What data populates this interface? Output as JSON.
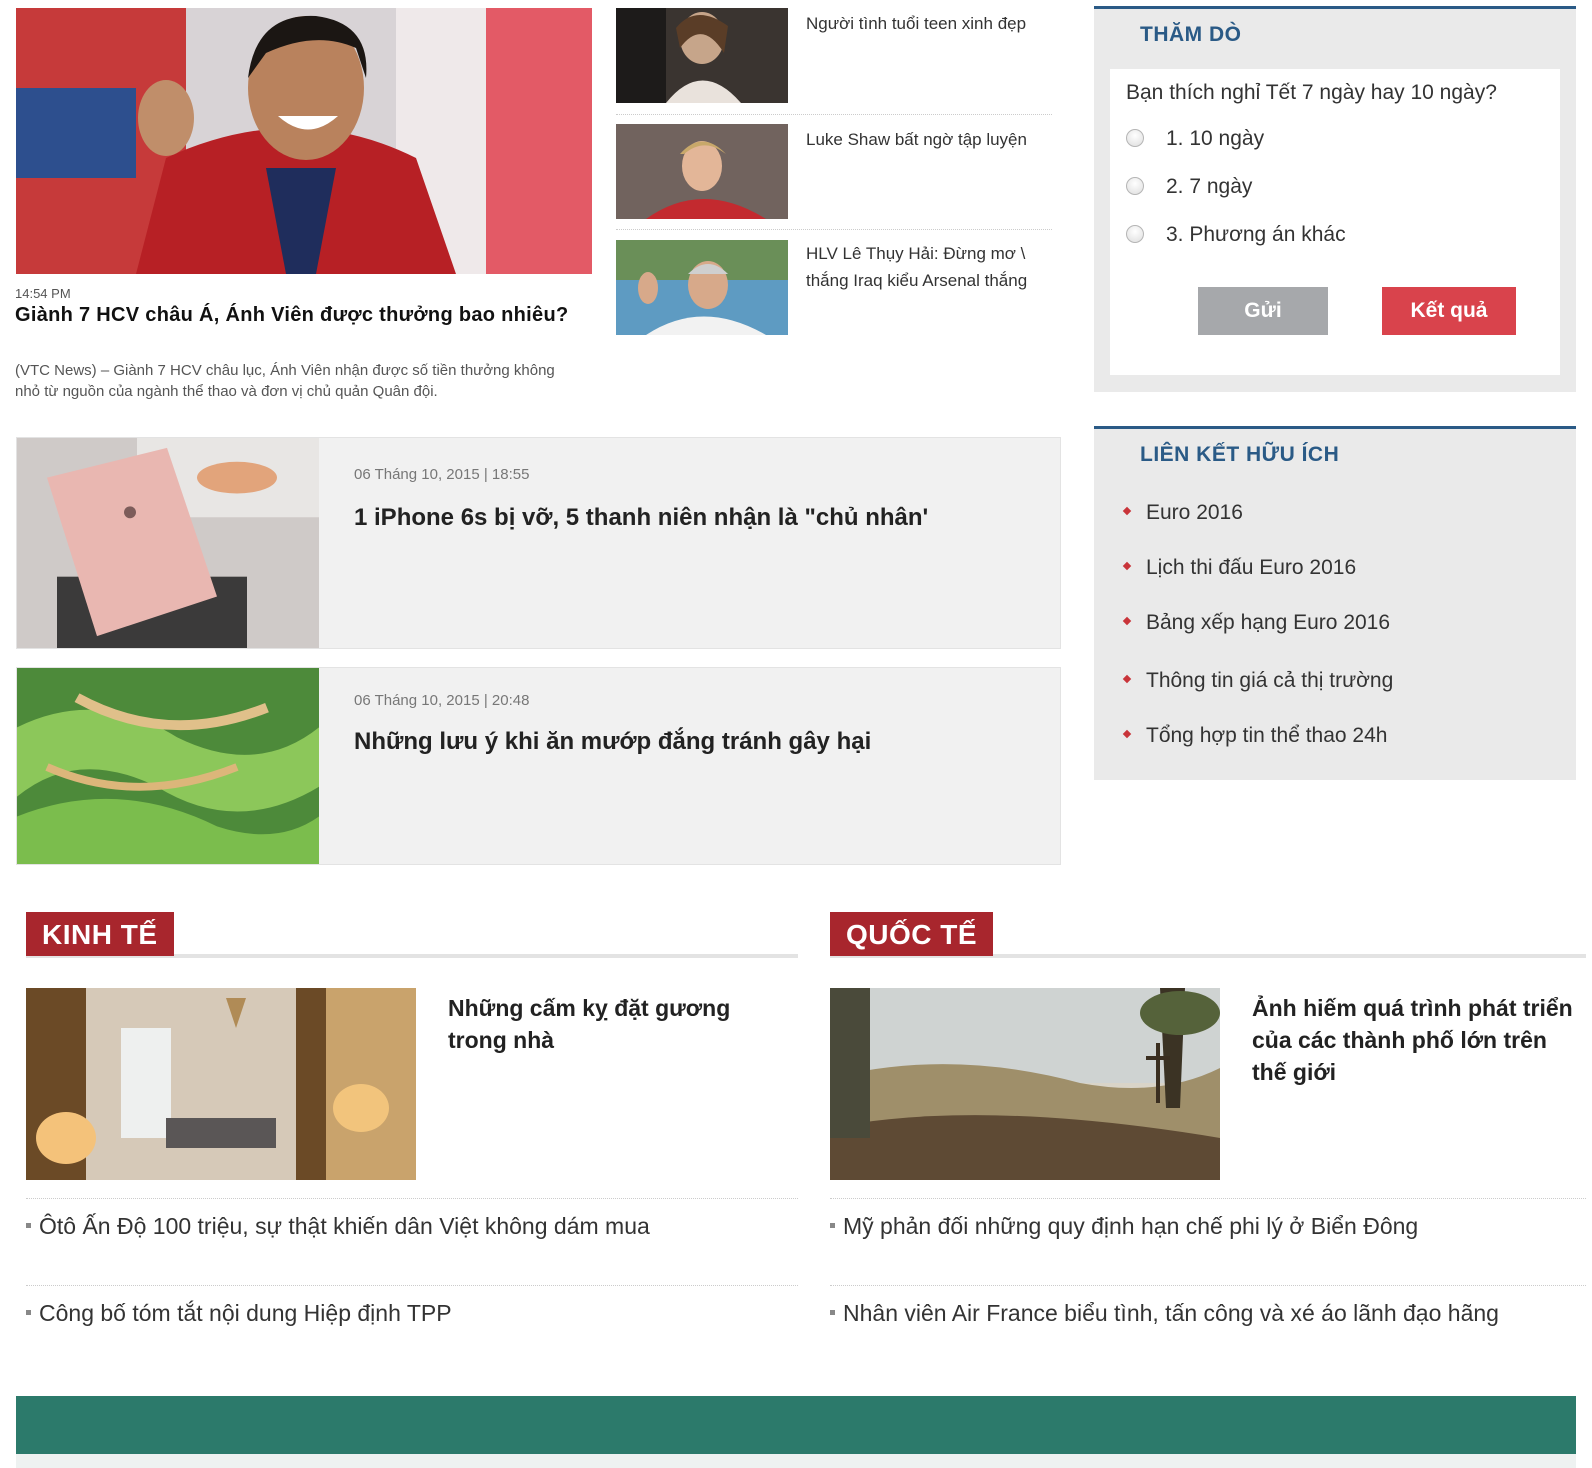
{
  "featured": {
    "time": "14:54 PM",
    "title": "Giành 7 HCV châu Á, Ánh Viên được thưởng bao nhiêu?",
    "sapo": "(VTC News) – Giành 7 HCV châu lục, Ánh Viên nhận được số tiền thưởng không nhỏ từ nguồn của ngành thể thao và đơn vị chủ quản Quân đội."
  },
  "small_news": [
    {
      "title": "Người tình tuổi teen xinh đẹp"
    },
    {
      "title": "Luke Shaw bất ngờ tập luyện"
    },
    {
      "title": "HLV Lê Thụy Hải: Đừng mơ \\ thắng Iraq kiểu Arsenal thắng"
    }
  ],
  "cards": [
    {
      "date": "06 Tháng 10, 2015 | 18:55",
      "title": "1 iPhone 6s bị vỡ, 5 thanh niên nhận là \"chủ nhân'"
    },
    {
      "date": "06 Tháng 10, 2015 | 20:48",
      "title": "Những lưu ý khi ăn mướp đắng tránh gây hại"
    }
  ],
  "poll": {
    "heading": "THĂM DÒ",
    "question": "Bạn thích nghỉ Tết 7 ngày hay 10 ngày?",
    "options": [
      "1. 10 ngày",
      "2. 7 ngày",
      "3. Phương án khác"
    ],
    "send_label": "Gửi",
    "result_label": "Kết quả"
  },
  "links": {
    "heading": "LIÊN KẾT HỮU ÍCH",
    "items": [
      "Euro 2016",
      "Lịch thi đấu Euro 2016",
      "Bảng xếp hạng Euro 2016",
      "Thông tin giá cả thị trường",
      "Tổng hợp tin thể thao 24h"
    ]
  },
  "kinh_te": {
    "label": "KINH TẾ",
    "feature_title": "Những cấm kỵ đặt gương trong nhà",
    "items": [
      "Ôtô Ấn Độ 100 triệu, sự thật khiến dân Việt không dám mua",
      "Công bố tóm tắt nội dung Hiệp định TPP"
    ]
  },
  "quoc_te": {
    "label": "QUỐC TẾ",
    "feature_title": "Ảnh hiếm quá trình phát triển của các thành phố lớn trên thế giới",
    "items": [
      "Mỹ phản đối những quy định hạn chế phi lý ở Biển Đông",
      "Nhân viên Air France biểu tình, tấn công và xé áo lãnh đạo hãng"
    ]
  },
  "colors": {
    "poll_heading": "#2a5a86",
    "section_label": "#a8262d",
    "result_button": "#d9434c",
    "send_button": "#a6a8ab",
    "footer": "#2c7a6b"
  }
}
